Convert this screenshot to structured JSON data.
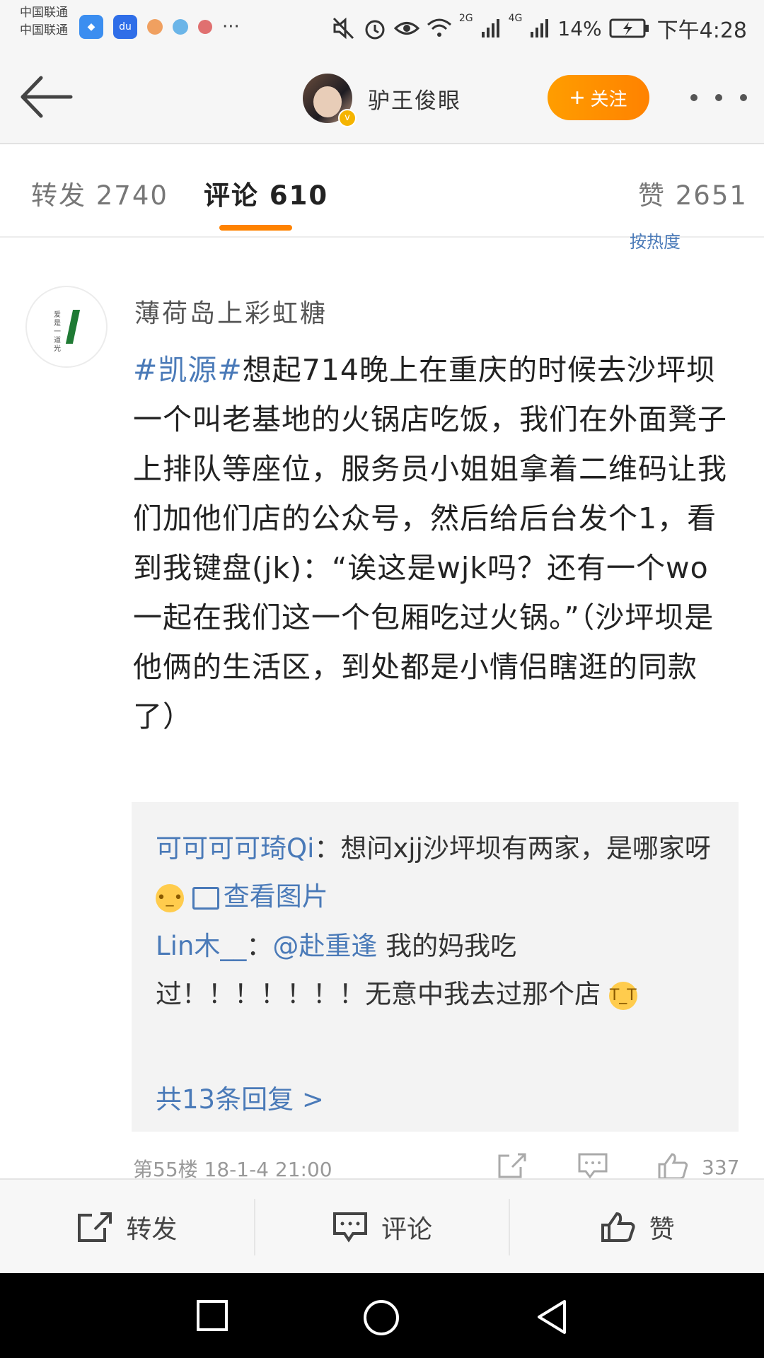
{
  "status_bar": {
    "carrier_1": "中国联通",
    "carrier_2": "中国联通",
    "more_dots": "···",
    "net_2g": "2G",
    "net_4g": "4G",
    "battery": "14%",
    "time": "下午4:28"
  },
  "header": {
    "user_name": "驴王俊眼",
    "follow_label": "关注",
    "follow_plus": "+"
  },
  "tabs": {
    "repost": "转发 2740",
    "comment": "评论 610",
    "like": "赞 2651"
  },
  "comment": {
    "cut_link": "按热度",
    "avatar_text": "爱是一道光",
    "author": "薄荷岛上彩虹糖",
    "hashtag": "#凯源#",
    "body": "想起714晚上在重庆的时候去沙坪坝一个叫老基地的火锅店吃饭，我们在外面凳子上排队等座位，服务员小姐姐拿着二维码让我们加他们店的公众号，然后给后台发个1，看到我键盘(jk)：“诶这是wjk吗？还有一个wo一起在我们这一个包厢吃过火锅。”（沙坪坝是他俩的生活区，到处都是小情侣瞎逛的同款了）",
    "replies": [
      {
        "user": "可可可可琦Qi",
        "sep": "：",
        "text": "想问xjj沙坪坝有两家，是哪家呀",
        "emoji": "pensive-face",
        "image_link": "查看图片"
      },
      {
        "user": "Lin木__",
        "sep": "：",
        "mention": "@赴重逢",
        "text": " 我的妈我吃过！！！！！！！无意中我去过那个店",
        "emoji": "crying-face"
      }
    ],
    "more_replies": "共13条回复 >",
    "floor_time": "第55楼 18-1-4 21:00",
    "like_count": "337"
  },
  "toolbar": {
    "repost": "转发",
    "comment": "评论",
    "like": "赞"
  },
  "colors": {
    "accent_orange": "#ff8200",
    "link_blue": "#4a7ab8",
    "reply_bg": "#f3f3f3"
  }
}
